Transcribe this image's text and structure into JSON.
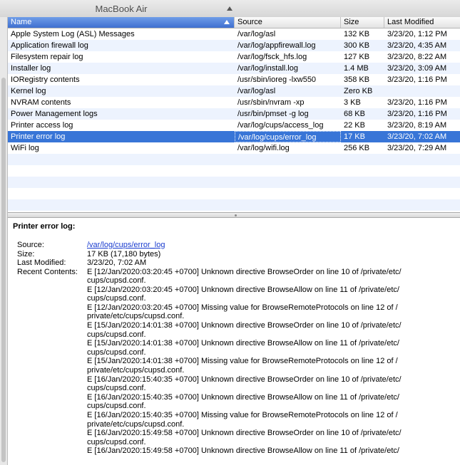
{
  "window": {
    "title": "MacBook Air"
  },
  "table": {
    "columns": [
      "Name",
      "Source",
      "Size",
      "Last Modified"
    ],
    "rows": [
      {
        "name": "Apple System Log (ASL) Messages",
        "source": "/var/log/asl",
        "size": "132 KB",
        "modified": "3/23/20, 1:12 PM"
      },
      {
        "name": "Application firewall log",
        "source": "/var/log/appfirewall.log",
        "size": "300 KB",
        "modified": "3/23/20, 4:35 AM"
      },
      {
        "name": "Filesystem repair log",
        "source": "/var/log/fsck_hfs.log",
        "size": "127 KB",
        "modified": "3/23/20, 8:22 AM"
      },
      {
        "name": "Installer log",
        "source": "/var/log/install.log",
        "size": "1.4 MB",
        "modified": "3/23/20, 3:09 AM"
      },
      {
        "name": "IORegistry contents",
        "source": "/usr/sbin/ioreg -lxw550",
        "size": "358 KB",
        "modified": "3/23/20, 1:16 PM"
      },
      {
        "name": "Kernel log",
        "source": "/var/log/asl",
        "size": "Zero KB",
        "modified": ""
      },
      {
        "name": "NVRAM contents",
        "source": "/usr/sbin/nvram -xp",
        "size": "3 KB",
        "modified": "3/23/20, 1:16 PM"
      },
      {
        "name": "Power Management logs",
        "source": "/usr/bin/pmset -g log",
        "size": "68 KB",
        "modified": "3/23/20, 1:16 PM"
      },
      {
        "name": "Printer access log",
        "source": "/var/log/cups/access_log",
        "size": "22 KB",
        "modified": "3/23/20, 8:19 AM"
      },
      {
        "name": "Printer error log",
        "source": "/var/log/cups/error_log",
        "size": "17 KB",
        "modified": "3/23/20, 7:02 AM"
      },
      {
        "name": "WiFi log",
        "source": "/var/log/wifi.log",
        "size": "256 KB",
        "modified": "3/23/20, 7:29 AM"
      }
    ],
    "selected_row": "Printer error log"
  },
  "detail": {
    "heading": "Printer error log:",
    "source_label": "Source:",
    "source_value": "/var/log/cups/error_log",
    "size_label": "Size:",
    "size_value": "17 KB (17,180 bytes)",
    "modified_label": "Last Modified:",
    "modified_value": "3/23/20, 7:02 AM",
    "contents_label": "Recent Contents:",
    "contents_lines": [
      "E [12/Jan/2020:03:20:45 +0700] Unknown directive BrowseOrder on line 10 of /private/etc/",
      "cups/cupsd.conf.",
      "E [12/Jan/2020:03:20:45 +0700] Unknown directive BrowseAllow on line 11 of /private/etc/",
      "cups/cupsd.conf.",
      "E [12/Jan/2020:03:20:45 +0700] Missing value for BrowseRemoteProtocols on line 12 of /",
      "private/etc/cups/cupsd.conf.",
      "E [15/Jan/2020:14:01:38 +0700] Unknown directive BrowseOrder on line 10 of /private/etc/",
      "cups/cupsd.conf.",
      "E [15/Jan/2020:14:01:38 +0700] Unknown directive BrowseAllow on line 11 of /private/etc/",
      "cups/cupsd.conf.",
      "E [15/Jan/2020:14:01:38 +0700] Missing value for BrowseRemoteProtocols on line 12 of /",
      "private/etc/cups/cupsd.conf.",
      "E [16/Jan/2020:15:40:35 +0700] Unknown directive BrowseOrder on line 10 of /private/etc/",
      "cups/cupsd.conf.",
      "E [16/Jan/2020:15:40:35 +0700] Unknown directive BrowseAllow on line 11 of /private/etc/",
      "cups/cupsd.conf.",
      "E [16/Jan/2020:15:40:35 +0700] Missing value for BrowseRemoteProtocols on line 12 of /",
      "private/etc/cups/cupsd.conf.",
      "E [16/Jan/2020:15:49:58 +0700] Unknown directive BrowseOrder on line 10 of /private/etc/",
      "cups/cupsd.conf.",
      "E [16/Jan/2020:15:49:58 +0700] Unknown directive BrowseAllow on line 11 of /private/etc/"
    ]
  },
  "colors": {
    "selection": "#3875d7",
    "stripe": "#edf3fe",
    "link": "#1a3ccf"
  }
}
